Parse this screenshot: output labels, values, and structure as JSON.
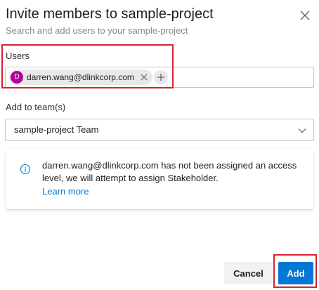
{
  "dialog": {
    "title": "Invite members to sample-project",
    "subtitle": "Search and add users to your sample-project"
  },
  "users": {
    "label": "Users",
    "chips": [
      {
        "initial": "D",
        "email": "darren.wang@dlinkcorp.com",
        "avatar_color": "#b4009e"
      }
    ]
  },
  "team": {
    "label": "Add to team(s)",
    "selected": "sample-project Team"
  },
  "info": {
    "message": "darren.wang@dlinkcorp.com has not been assigned an access level, we will attempt to assign Stakeholder.",
    "link": "Learn more"
  },
  "buttons": {
    "cancel": "Cancel",
    "add": "Add"
  },
  "colors": {
    "accent": "#0078d4",
    "highlight": "#d9232e"
  },
  "icons": [
    "close-icon",
    "remove-icon",
    "plus-icon",
    "chevron-down-icon",
    "info-icon"
  ]
}
